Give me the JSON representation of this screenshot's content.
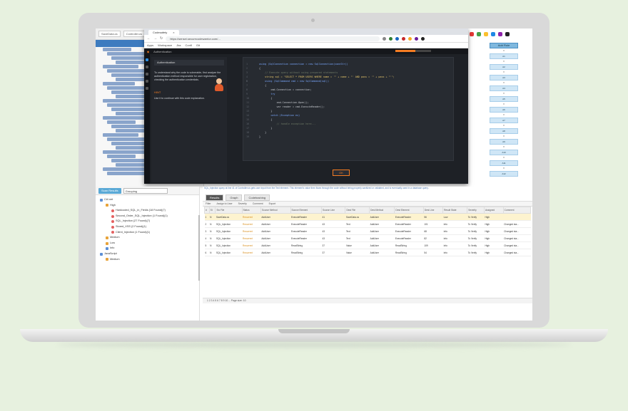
{
  "editor": {
    "tabs": [
      "SaveData.cs",
      "Controller.cs"
    ]
  },
  "browser": {
    "tab_title": "Codesafety",
    "url": "https://sensei.securecodewarrior.com/...",
    "bookmarks": [
      "Apps",
      "Workspace",
      "Jira",
      "Confl",
      "Git"
    ]
  },
  "app": {
    "lesson_title": "Authentication",
    "lesson_text": "To understand why the code is vulnerable, first analyze the authentication method responsible for user registration, checking the authentication credentials.",
    "lesson_highlight": "authentication credentials",
    "hint_label": "HINT",
    "hint_text": "Use it to continue with this code explanation.",
    "ok_label": "OK",
    "progress": 0.55,
    "code_lines": [
      {
        "n": "1",
        "t": "using (SqlConnection connection = new SqlConnection(connStr))",
        "k": "kw"
      },
      {
        "n": "2",
        "t": "{",
        "k": ""
      },
      {
        "n": "3",
        "t": "    // Execute query without using prepared statements",
        "k": "cm"
      },
      {
        "n": "4",
        "t": "    string sql = \"SELECT * FROM USERS WHERE name = '\" + name + \"' AND pass = '\" + pass + \"'\";",
        "k": "str"
      },
      {
        "n": "5",
        "t": "",
        "k": ""
      },
      {
        "n": "6",
        "t": "    using (SqlCommand cmd = new SqlCommand(sql))",
        "k": "kw"
      },
      {
        "n": "7",
        "t": "    {",
        "k": ""
      },
      {
        "n": "8",
        "t": "        cmd.Connection = connection;",
        "k": ""
      },
      {
        "n": "9",
        "t": "        try",
        "k": "kw"
      },
      {
        "n": "10",
        "t": "        {",
        "k": ""
      },
      {
        "n": "11",
        "t": "            cmd.Connection.Open();",
        "k": ""
      },
      {
        "n": "12",
        "t": "            var reader = cmd.ExecuteReader();",
        "k": ""
      },
      {
        "n": "13",
        "t": "        }",
        "k": ""
      },
      {
        "n": "14",
        "t": "        catch (Exception ex)",
        "k": "kw"
      },
      {
        "n": "15",
        "t": "        {",
        "k": ""
      },
      {
        "n": "16",
        "t": "            // handle exception here...",
        "k": "cm"
      },
      {
        "n": "17",
        "t": "        }",
        "k": ""
      },
      {
        "n": "18",
        "t": "    }",
        "k": ""
      },
      {
        "n": "19",
        "t": "}",
        "k": ""
      }
    ]
  },
  "rpanel": {
    "button_label": "Add Rule",
    "items": [
      "A1",
      "A2",
      "A3",
      "A4",
      "A5",
      "A6",
      "A7",
      "A8",
      "A9",
      "A10",
      "A11",
      "A12"
    ]
  },
  "issues": {
    "button_label": "Scan Results",
    "select_value": "Grouping",
    "tree": [
      {
        "indent": 0,
        "icon": "tb",
        "label": "C#/.net"
      },
      {
        "indent": 1,
        "icon": "tw",
        "label": "High"
      },
      {
        "indent": 2,
        "icon": "tr",
        "label": "Hardcoded_SQL_in_Fields  (18 Found)(7)"
      },
      {
        "indent": 2,
        "icon": "tr",
        "label": "Second_Order_SQL_Injection  (1 Found)(1)"
      },
      {
        "indent": 2,
        "icon": "tr",
        "label": "SQL_Injection  (27 Found)(7)"
      },
      {
        "indent": 2,
        "icon": "tr",
        "label": "Stored_XSS  (2 Found)(1)"
      },
      {
        "indent": 2,
        "icon": "tr",
        "label": "Client_Injection  (1 Found)(1)"
      },
      {
        "indent": 1,
        "icon": "tw",
        "label": "Medium"
      },
      {
        "indent": 1,
        "icon": "tw",
        "label": "Low"
      },
      {
        "indent": 1,
        "icon": "tb",
        "label": "Info"
      },
      {
        "indent": 0,
        "icon": "tb",
        "label": "JavaScript"
      },
      {
        "indent": 1,
        "icon": "tw",
        "label": "Medium"
      }
    ]
  },
  "findings": {
    "description": "SQL_Injection query at line 41 of Controller.cs gets user input from the Text element. This element's value then flows through the code without being properly sanitized or validated, and is eventually used in a database query.",
    "tabs": [
      "Results",
      "Graph",
      "Codebashing"
    ],
    "toolbar": [
      "Filter",
      "Assign to User",
      "Severity",
      "Comment",
      "Export"
    ],
    "columns": [
      "#",
      "St",
      "Src File",
      "Status",
      "Source Method",
      "Source Element",
      "Source Line",
      "Dest File",
      "Dest Method",
      "Dest Element",
      "Dest Line",
      "Result State",
      "Severity",
      "Assigned",
      "Comment"
    ],
    "rows": [
      [
        "1",
        "N",
        "SaveData.cs",
        "Recurrent",
        "AddUser",
        "ExecuteReader",
        "41",
        "SaveData.cs",
        "AddUser",
        "ExecuteReader",
        "56",
        "Low",
        "To Verify",
        "High",
        ""
      ],
      [
        "2",
        "N",
        "SQL_Injection",
        "Recurrent",
        "AddUser",
        "ExecuteReader",
        "43",
        "Text",
        "AddUser",
        "ExecuteReader",
        "101",
        "Info",
        "To Verify",
        "High",
        "Changed sta..."
      ],
      [
        "3",
        "N",
        "SQL_Injection",
        "Recurrent",
        "AddUser",
        "ExecuteReader",
        "43",
        "Text",
        "AddUser",
        "ExecuteReader",
        "68",
        "Info",
        "To Verify",
        "High",
        "Changed sta..."
      ],
      [
        "4",
        "N",
        "SQL_Injection",
        "Recurrent",
        "AddUser",
        "ExecuteReader",
        "43",
        "Text",
        "AddUser",
        "ExecuteReader",
        "82",
        "Info",
        "To Verify",
        "High",
        "Changed sta..."
      ],
      [
        "5",
        "N",
        "SQL_Injection",
        "Recurrent",
        "AddUser",
        "ReadString",
        "37",
        "Value",
        "AddUser",
        "ReadString",
        "109",
        "Info",
        "To Verify",
        "High",
        "Changed sta..."
      ],
      [
        "6",
        "N",
        "SQL_Injection",
        "Recurrent",
        "AddUser",
        "ReadString",
        "37",
        "Value",
        "AddUser",
        "ReadString",
        "54",
        "Info",
        "To Verify",
        "High",
        "Changed sta..."
      ]
    ],
    "pager": "1 2 3 4 5 6 7 8 9 10  ...  Page size: 10"
  }
}
